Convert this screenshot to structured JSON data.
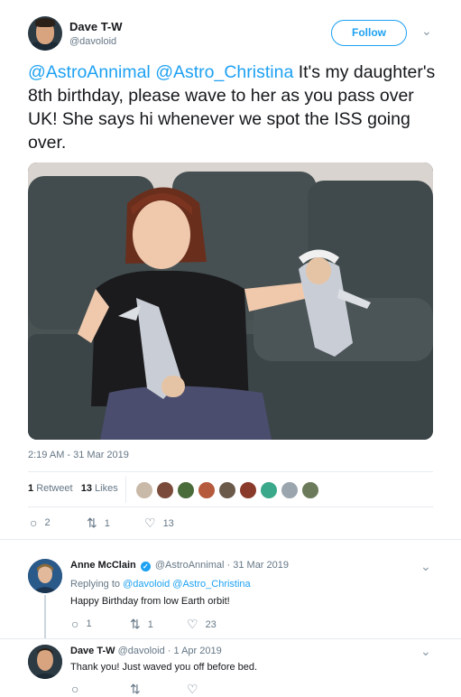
{
  "tweet": {
    "author_name": "Dave T-W",
    "author_handle": "@davoloid",
    "follow_label": "Follow",
    "text_mention_1": "@AstroAnnimal",
    "text_mention_2": "@Astro_Christina",
    "text_body": "It's my daughter's 8th birthday, please wave to her as you pass over UK! She says hi whenever we spot the ISS going over.",
    "timestamp": "2:19 AM - 31 Mar 2019",
    "retweet_count": "1",
    "retweet_label": "Retweet",
    "likes_count": "13",
    "likes_label": "Likes",
    "actions": {
      "replies": "2",
      "retweets": "1",
      "likes": "13"
    }
  },
  "likers_colors": [
    "#c9b9a8",
    "#7a4b3a",
    "#4a6b3a",
    "#b55a3c",
    "#6b5a4a",
    "#8a3a2a",
    "#3aa88a",
    "#9aa5ad",
    "#6a7a5a"
  ],
  "replies": [
    {
      "author_name": "Anne McClain",
      "author_handle": "@AstroAnnimal",
      "date": "· 31 Mar 2019",
      "replying_label": "Replying to",
      "replying_handles": "@davoloid @Astro_Christina",
      "text": "Happy Birthday from low Earth orbit!",
      "replies": "1",
      "retweets": "1",
      "likes": "23"
    },
    {
      "author_name": "Dave T-W",
      "author_handle": "@davoloid",
      "date": "· 1 Apr 2019",
      "text": "Thank you! Just waved you off before bed."
    }
  ],
  "icons": {
    "reply": "reply-icon",
    "retweet": "retweet-icon",
    "like": "heart-icon",
    "chevron": "chevron-down-icon",
    "verified": "verified-badge-icon"
  },
  "colors": {
    "accent": "#1da1f2",
    "muted": "#657786"
  }
}
